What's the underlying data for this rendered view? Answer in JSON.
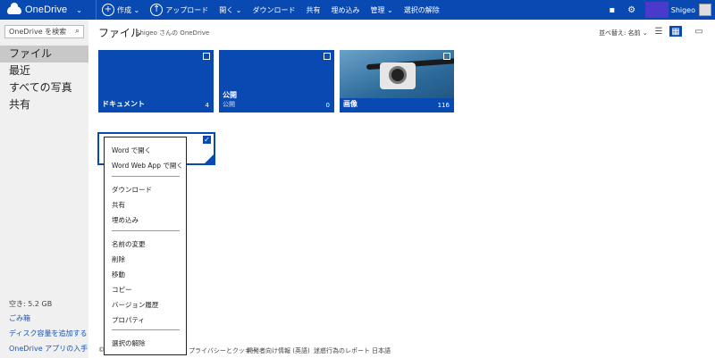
{
  "topbar": {
    "brand": "OneDrive",
    "commands": [
      {
        "icon": "plus-icon",
        "label": "作成 ⌄"
      },
      {
        "icon": "upload-icon",
        "label": "アップロード"
      },
      {
        "icon": "",
        "label": "開く ⌄"
      },
      {
        "icon": "",
        "label": "ダウンロード"
      },
      {
        "icon": "",
        "label": "共有"
      },
      {
        "icon": "",
        "label": "埋め込み"
      },
      {
        "icon": "",
        "label": "管理 ⌄"
      },
      {
        "icon": "",
        "label": "選択の解除"
      }
    ],
    "user_name": "Shigeo",
    "accent": "#094ab2"
  },
  "sidebar": {
    "search_placeholder": "OneDrive を検索",
    "nav": [
      "ファイル",
      "最近",
      "すべての写真",
      "共有"
    ],
    "storage": "空き: 5.2 GB",
    "links": [
      "ごみ箱",
      "ディスク容量を追加する",
      "OneDrive アプリの入手"
    ]
  },
  "main": {
    "title": "ファイル",
    "subtitle": "Shigeo さんの OneDrive",
    "sort_label": "並べ替え: 名前 ⌄"
  },
  "tiles": [
    {
      "label": "ドキュメント",
      "count": "4"
    },
    {
      "label": "公開",
      "sub": "公開",
      "count": "0"
    },
    {
      "label": "画像",
      "count": "116"
    }
  ],
  "context_menu": {
    "items": [
      "Word で開く",
      "Word Web App で開く",
      "ダウンロード",
      "共有",
      "埋め込み",
      "名前の変更",
      "削除",
      "移動",
      "コピー",
      "バージョン履歴",
      "プロパティ",
      "選択の解除"
    ]
  },
  "footer": {
    "left": "©",
    "links": [
      "プライバシーとクッキー",
      "開発者向け情報 (英語)",
      "迷惑行為のレポート",
      "日本語"
    ]
  }
}
